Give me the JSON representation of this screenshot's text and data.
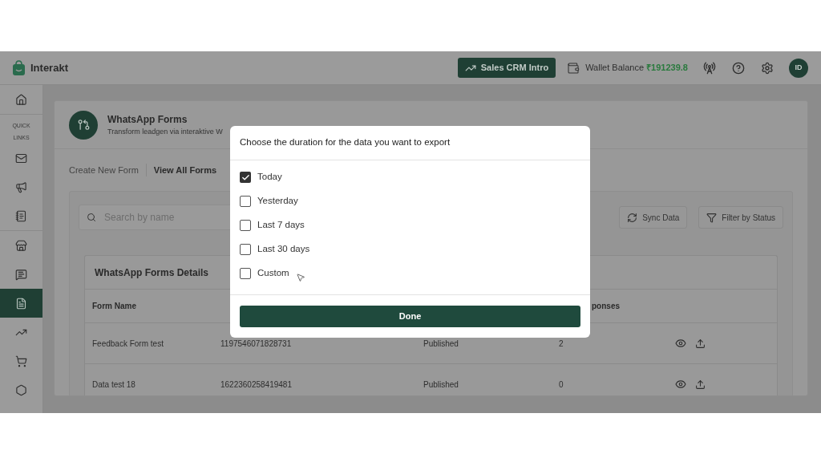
{
  "app": {
    "name": "Interakt"
  },
  "header": {
    "button": "Sales CRM Intro",
    "wallet_label": "Wallet Balance",
    "wallet_amount": "₹191239.8",
    "avatar": "ID"
  },
  "sidebar": {
    "groups": [
      {
        "items": [
          {
            "kind": "home",
            "selected": false
          }
        ]
      },
      {
        "label": "QUICK LINKS",
        "items": [
          {
            "kind": "mail",
            "selected": false
          },
          {
            "kind": "megaphone",
            "selected": false
          },
          {
            "kind": "notebook",
            "selected": false
          }
        ]
      },
      {
        "items": [
          {
            "kind": "store",
            "selected": false
          },
          {
            "kind": "chat",
            "selected": false
          },
          {
            "kind": "form",
            "selected": true
          },
          {
            "kind": "sales",
            "selected": false
          },
          {
            "kind": "cart",
            "selected": false
          },
          {
            "kind": "hexagon",
            "selected": false
          }
        ]
      }
    ]
  },
  "page": {
    "title": "WhatsApp Forms",
    "subtitle": "Transform leadgen via interaktive W",
    "tabs": [
      {
        "label": "Create New Form",
        "selected": false
      },
      {
        "label": "View All Forms",
        "selected": true
      }
    ],
    "search": {
      "placeholder": "Search by name"
    },
    "buttons": [
      {
        "kind": "sync",
        "label": "Sync Data"
      },
      {
        "kind": "filter",
        "label": "Filter by Status"
      }
    ],
    "table": {
      "title": "WhatsApp Forms Details",
      "columns": {
        "form_name": "Form Name",
        "responses": "ponses"
      },
      "rows": [
        {
          "form_name": "Feedback Form test",
          "form_id": "1197546071828731",
          "status": "Published",
          "responses": "2"
        },
        {
          "form_name": "Data test 18",
          "form_id": "1622360258419481",
          "status": "Published",
          "responses": "0"
        }
      ]
    }
  },
  "dialog": {
    "title": "Choose the duration for the data you want to export",
    "options": [
      {
        "label": "Today",
        "checked": true
      },
      {
        "label": "Yesterday",
        "checked": false
      },
      {
        "label": "Last 7 days",
        "checked": false
      },
      {
        "label": "Last 30 days",
        "checked": false
      },
      {
        "label": "Custom",
        "checked": false
      }
    ],
    "button": "Done"
  }
}
